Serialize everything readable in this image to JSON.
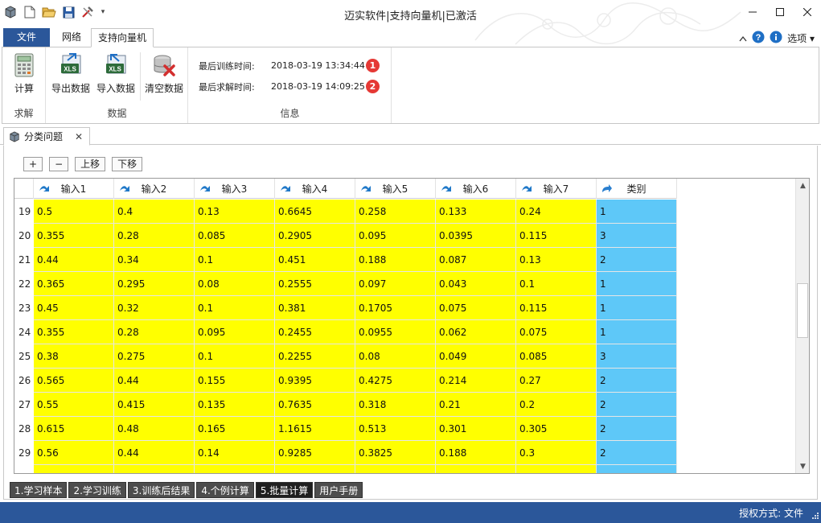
{
  "window": {
    "title": "迈实软件|支持向量机|已激活",
    "controls": [
      "minimize",
      "maximize",
      "close"
    ]
  },
  "ribbon_tabs": {
    "file": "文件",
    "items": [
      "网络",
      "支持向量机"
    ],
    "active": "支持向量机",
    "right_label": "选项"
  },
  "ribbon": {
    "groups": {
      "solve": {
        "label": "求解",
        "buttons": [
          "计算"
        ]
      },
      "data": {
        "label": "数据",
        "buttons": [
          "导出数据",
          "导入数据",
          "清空数据"
        ]
      },
      "info": {
        "label": "信息",
        "rows": [
          {
            "label": "最后训练时间:",
            "value": "2018-03-19 13:34:44",
            "badge": "1"
          },
          {
            "label": "最后求解时间:",
            "value": "2018-03-19 14:09:25",
            "badge": "2"
          }
        ]
      }
    }
  },
  "doc_tab": {
    "label": "分类问题"
  },
  "toolbar": {
    "add": "+",
    "remove": "−",
    "up": "上移",
    "down": "下移"
  },
  "grid": {
    "headers": [
      "输入1",
      "输入2",
      "输入3",
      "输入4",
      "输入5",
      "输入6",
      "输入7",
      "类别"
    ],
    "rows": [
      {
        "n": "19",
        "v": [
          "0.5",
          "0.4",
          "0.13",
          "0.6645",
          "0.258",
          "0.133",
          "0.24",
          "1"
        ]
      },
      {
        "n": "20",
        "v": [
          "0.355",
          "0.28",
          "0.085",
          "0.2905",
          "0.095",
          "0.0395",
          "0.115",
          "3"
        ]
      },
      {
        "n": "21",
        "v": [
          "0.44",
          "0.34",
          "0.1",
          "0.451",
          "0.188",
          "0.087",
          "0.13",
          "2"
        ]
      },
      {
        "n": "22",
        "v": [
          "0.365",
          "0.295",
          "0.08",
          "0.2555",
          "0.097",
          "0.043",
          "0.1",
          "1"
        ]
      },
      {
        "n": "23",
        "v": [
          "0.45",
          "0.32",
          "0.1",
          "0.381",
          "0.1705",
          "0.075",
          "0.115",
          "1"
        ]
      },
      {
        "n": "24",
        "v": [
          "0.355",
          "0.28",
          "0.095",
          "0.2455",
          "0.0955",
          "0.062",
          "0.075",
          "1"
        ]
      },
      {
        "n": "25",
        "v": [
          "0.38",
          "0.275",
          "0.1",
          "0.2255",
          "0.08",
          "0.049",
          "0.085",
          "3"
        ]
      },
      {
        "n": "26",
        "v": [
          "0.565",
          "0.44",
          "0.155",
          "0.9395",
          "0.4275",
          "0.214",
          "0.27",
          "2"
        ]
      },
      {
        "n": "27",
        "v": [
          "0.55",
          "0.415",
          "0.135",
          "0.7635",
          "0.318",
          "0.21",
          "0.2",
          "2"
        ]
      },
      {
        "n": "28",
        "v": [
          "0.615",
          "0.48",
          "0.165",
          "1.1615",
          "0.513",
          "0.301",
          "0.305",
          "2"
        ]
      },
      {
        "n": "29",
        "v": [
          "0.56",
          "0.44",
          "0.14",
          "0.9285",
          "0.3825",
          "0.188",
          "0.3",
          "2"
        ]
      }
    ]
  },
  "bottom_tabs": {
    "items": [
      "1.学习样本",
      "2.学习训练",
      "3.训练后结果",
      "4.个例计算",
      "5.批量计算",
      "用户手册"
    ],
    "active_index": 4
  },
  "status": {
    "text": "授权方式: 文件"
  },
  "colors": {
    "accent": "#2b579a",
    "input_cell": "#ffff00",
    "class_cell": "#5ec8f8",
    "badge": "#e53935"
  }
}
